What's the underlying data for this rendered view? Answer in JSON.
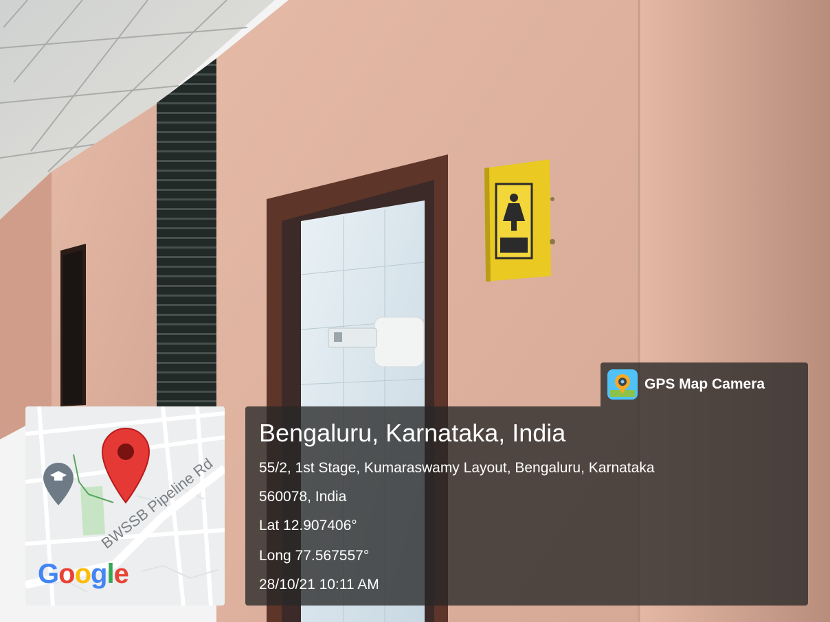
{
  "photo": {
    "description_colors": {
      "wall": "#d8ab97",
      "frame": "#5e3529",
      "sign": "#eac922",
      "ceiling": "#d9d7d2"
    }
  },
  "overlay": {
    "app_name": "GPS Map Camera",
    "app_icon": "camera-pin-icon",
    "location_title": "Bengaluru, Karnataka, India",
    "address_line1": "55/2, 1st Stage, Kumaraswamy Layout, Bengaluru, Karnataka",
    "address_line2": "560078, India",
    "latitude": "Lat 12.907406°",
    "longitude": "Long 77.567557°",
    "timestamp": "28/10/21 10:11 AM"
  },
  "map": {
    "road_label": "BWSSB Pipeline Rd",
    "logo_text": "Google",
    "pin_icon": "location-pin-icon",
    "poi_icon": "graduation-cap-icon",
    "pin_color": "#e53935"
  }
}
